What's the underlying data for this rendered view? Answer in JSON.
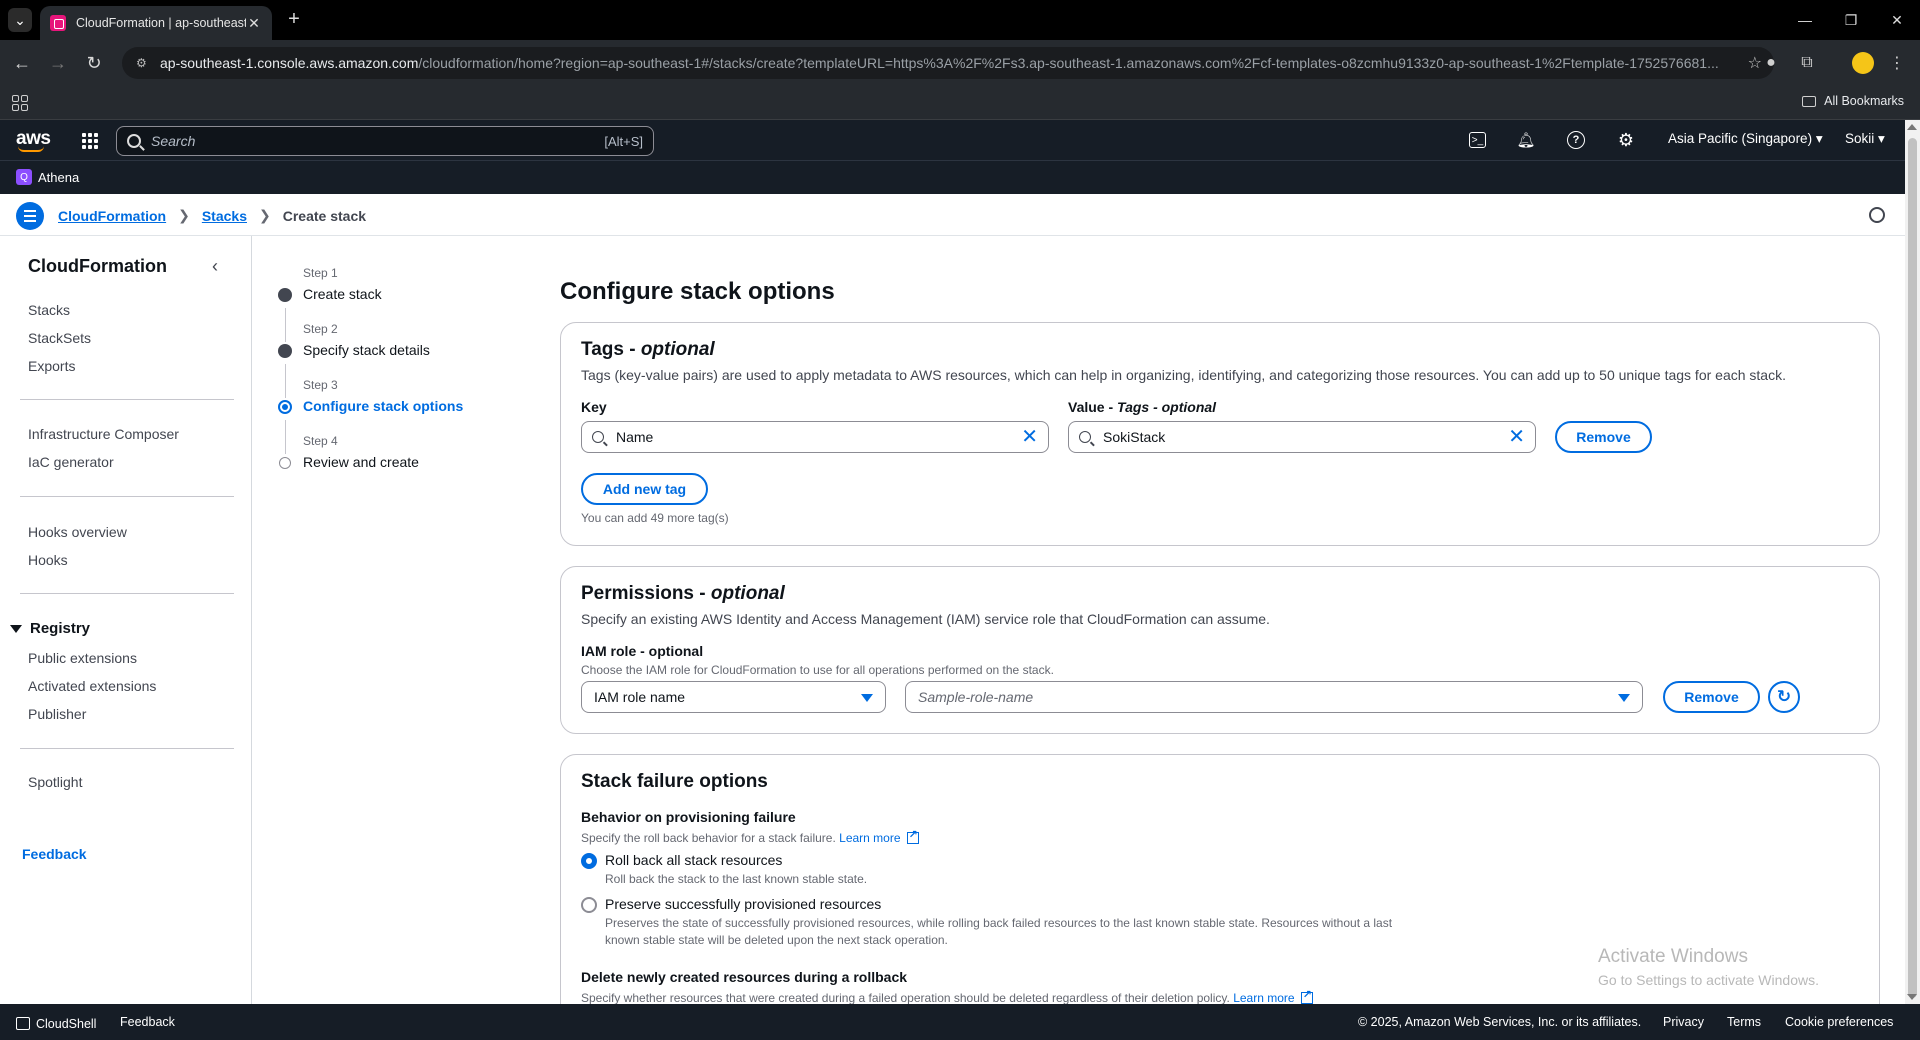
{
  "browser": {
    "tab_title": "CloudFormation | ap-southeast",
    "url_host": "ap-southeast-1.console.aws.amazon.com",
    "url_path": "/cloudformation/home?region=ap-southeast-1#/stacks/create?templateURL=https%3A%2F%2Fs3.ap-southeast-1.amazonaws.com%2Fcf-templates-o8zcmhu9133z0-ap-southeast-1%2Ftemplate-1752576681...",
    "all_bookmarks": "All Bookmarks"
  },
  "aws_header": {
    "logo": "aws",
    "search_placeholder": "Search",
    "search_shortcut": "[Alt+S]",
    "region": "Asia Pacific (Singapore) ▾",
    "user": "Sokii ▾",
    "favorite_service": "Athena"
  },
  "breadcrumb": {
    "items": [
      "CloudFormation",
      "Stacks"
    ],
    "current": "Create stack"
  },
  "sidebar": {
    "title": "CloudFormation",
    "group1": [
      "Stacks",
      "StackSets",
      "Exports"
    ],
    "group2": [
      "Infrastructure Composer",
      "IaC generator"
    ],
    "group3": [
      "Hooks overview",
      "Hooks"
    ],
    "registry_title": "Registry",
    "registry_items": [
      "Public extensions",
      "Activated extensions",
      "Publisher"
    ],
    "group4": [
      "Spotlight"
    ],
    "feedback": "Feedback"
  },
  "steps": [
    {
      "label": "Step 1",
      "name": "Create stack",
      "state": "done"
    },
    {
      "label": "Step 2",
      "name": "Specify stack details",
      "state": "done"
    },
    {
      "label": "Step 3",
      "name": "Configure stack options",
      "state": "current"
    },
    {
      "label": "Step 4",
      "name": "Review and create",
      "state": "todo"
    }
  ],
  "page_title": "Configure stack options",
  "tags": {
    "title": "Tags",
    "title_suffix": "optional",
    "description": "Tags (key-value pairs) are used to apply metadata to AWS resources, which can help in organizing, identifying, and categorizing those resources. You can add up to 50 unique tags for each stack.",
    "key_label": "Key",
    "value_label": "Value - ",
    "value_label_suffix": "Tags - optional",
    "key_value": "Name",
    "value_value": "SokiStack",
    "remove": "Remove",
    "add_new": "Add new tag",
    "remaining": "You can add 49 more tag(s)"
  },
  "permissions": {
    "title": "Permissions",
    "title_suffix": "optional",
    "description": "Specify an existing AWS Identity and Access Management (IAM) service role that CloudFormation can assume.",
    "iam_label": "IAM role - optional",
    "iam_desc": "Choose the IAM role for CloudFormation to use for all operations performed on the stack.",
    "select_value": "IAM role name",
    "role_placeholder": "Sample-role-name",
    "remove": "Remove"
  },
  "failure": {
    "title": "Stack failure options",
    "behavior_label": "Behavior on provisioning failure",
    "behavior_desc": "Specify the roll back behavior for a stack failure.",
    "learn_more": "Learn more",
    "opt1_label": "Roll back all stack resources",
    "opt1_desc": "Roll back the stack to the last known stable state.",
    "opt2_label": "Preserve successfully provisioned resources",
    "opt2_desc": "Preserves the state of successfully provisioned resources, while rolling back failed resources to the last known stable state. Resources without a last known stable state will be deleted upon the next stack operation.",
    "delete_label": "Delete newly created resources during a rollback",
    "delete_desc": "Specify whether resources that were created during a failed operation should be deleted regardless of their deletion policy."
  },
  "watermark": {
    "line1": "Activate Windows",
    "line2": "Go to Settings to activate Windows."
  },
  "footer": {
    "cloudshell": "CloudShell",
    "feedback": "Feedback",
    "copyright": "© 2025, Amazon Web Services, Inc. or its affiliates.",
    "privacy": "Privacy",
    "terms": "Terms",
    "cookies": "Cookie preferences"
  }
}
